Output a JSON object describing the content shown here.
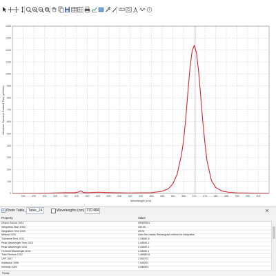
{
  "toolbar": {
    "icons": [
      "pointer-icon",
      "crosshair-icon",
      "pan-arrows-icon",
      "vertical-arrow-icon",
      "zoom-region-icon",
      "zoom-in-icon",
      "zoom-out-icon",
      "zoom-fit-icon",
      "hand-icon",
      "copy-icon",
      "save-icon",
      "table-icon",
      "grid-icon",
      "print-icon",
      "chart-icon",
      "marker-icon",
      "tools-icon",
      "line-icon",
      "measure-icon",
      "zoom-window-icon",
      "peak-icon",
      "waveform-icon",
      "help-icon"
    ]
  },
  "chart_data": {
    "type": "line",
    "title": "",
    "xlabel": "Wavelength (nm)",
    "ylabel": "Absolute Spectral Radiant Flux (µW/nm)",
    "xlim": [
      285,
      405
    ],
    "ylim": [
      0,
      1400
    ],
    "x_ticks": [
      290,
      295,
      300,
      305,
      310,
      315,
      320,
      325,
      330,
      335,
      340,
      345,
      350,
      355,
      360,
      365,
      370,
      375,
      380,
      385,
      390,
      395,
      400
    ],
    "y_ticks": [
      0,
      100,
      200,
      300,
      400,
      500,
      600,
      700,
      800,
      900,
      1000,
      1100,
      1200,
      1300,
      1400
    ],
    "grid": true,
    "series": [
      {
        "color": "#d3262f",
        "x": [
          285,
          300,
          310,
          314,
          316,
          317,
          318,
          320,
          325,
          330,
          340,
          350,
          355,
          358,
          360,
          362,
          364,
          365,
          366,
          367,
          368,
          369,
          370,
          371,
          372,
          373,
          374,
          375,
          376,
          378,
          380,
          383,
          386,
          390,
          395,
          400,
          405
        ],
        "y": [
          0,
          2,
          6,
          6,
          12,
          22,
          8,
          6,
          10,
          7,
          4,
          6,
          18,
          40,
          80,
          160,
          320,
          440,
          620,
          840,
          1050,
          1190,
          1240,
          1180,
          1030,
          820,
          600,
          420,
          270,
          110,
          50,
          20,
          10,
          5,
          3,
          2,
          1
        ]
      }
    ],
    "marker_line_x": 370.5
  },
  "bottom_bar": {
    "tab1_label": "Photo Table_20",
    "tab2_label": "Table_24",
    "checkbox_label": "Wavelengths (nm)",
    "range_value": "370.484"
  },
  "properties": {
    "col_property": "Property",
    "col_value": "Value",
    "rows": [
      {
        "name": "Device Source 1001",
        "value": "HR4000#1"
      },
      {
        "name": "Integration Start 1002",
        "value": "432.00"
      },
      {
        "name": "Integration Time 1003",
        "value": "29.00"
      },
      {
        "name": "Method 1004",
        "value": "Uses the classic Rectangular method for integration"
      },
      {
        "name": "Tolerance Time 1011",
        "value": "1.3466E-6"
      },
      {
        "name": "Peak Wavelength Time 1013",
        "value": "2.4450E-1"
      },
      {
        "name": "Peak Wavelength 1015",
        "value": "2.4450E-1"
      },
      {
        "name": "Centroid Wavelength 1016",
        "value": "2.4450E-1"
      },
      {
        "name": "Total Photons 1012",
        "value": "1.4868E16"
      },
      {
        "name": "UPF 1007",
        "value": "2.5557E2"
      },
      {
        "name": "Irradiance 1006",
        "value": "7.5453E2"
      },
      {
        "name": "Intensity 1008",
        "value": "3.5560E2"
      }
    ]
  },
  "status": {
    "text": "Ready"
  }
}
